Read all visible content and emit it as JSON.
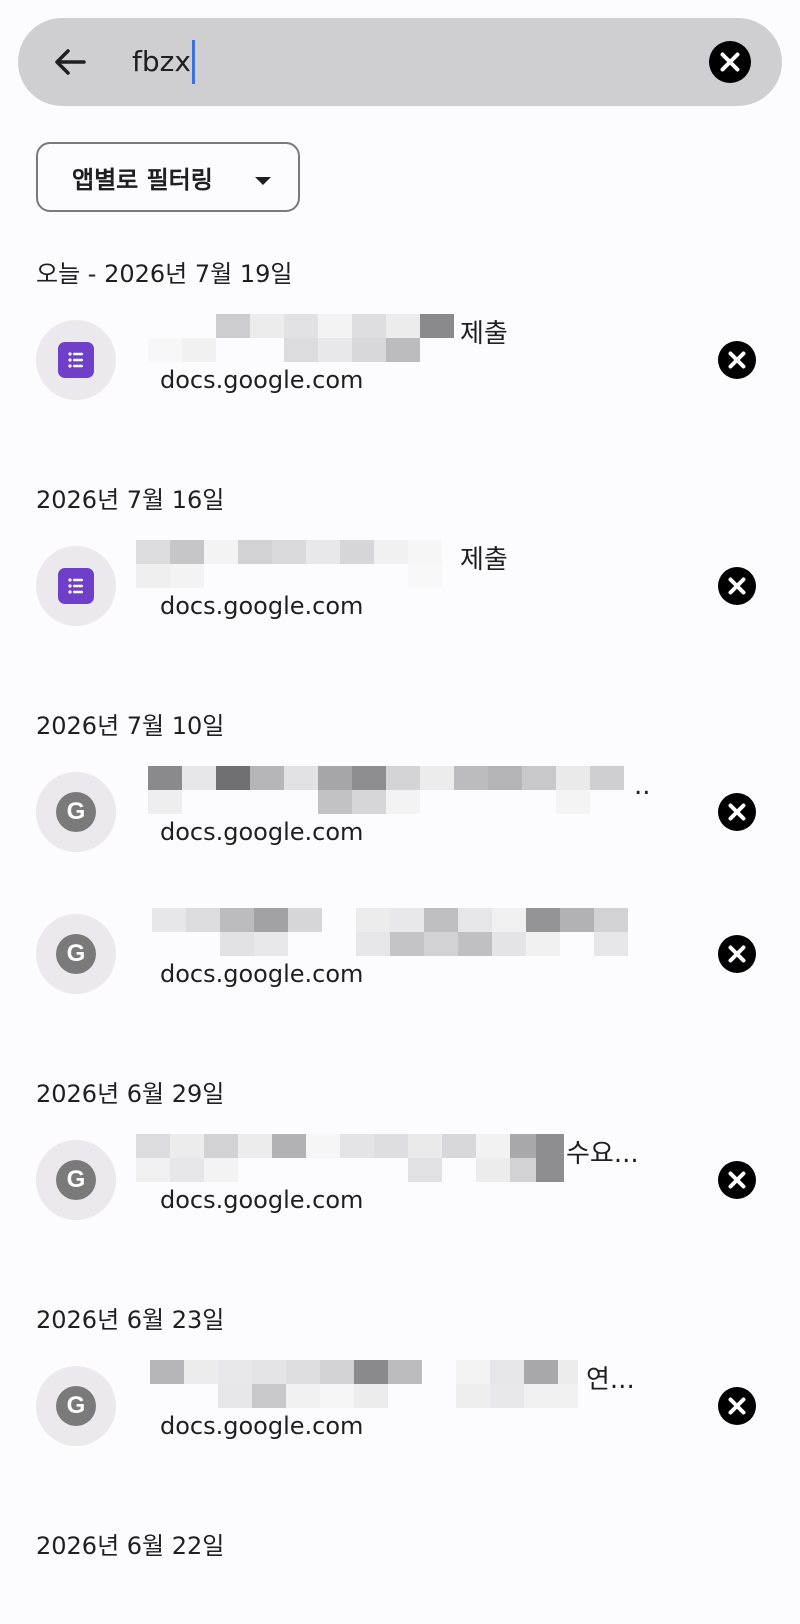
{
  "search": {
    "query": "fbzx"
  },
  "filter": {
    "label": "앱별로 필터링"
  },
  "groups": [
    {
      "date": "오늘 - 2026년 7월 19일"
    },
    {
      "date": "2026년 7월 16일"
    },
    {
      "date": "2026년 7월 10일"
    },
    {
      "date": "2026년 6월 29일"
    },
    {
      "date": "2026년 6월 23일"
    },
    {
      "date": "2026년 6월 22일"
    }
  ],
  "items": [
    {
      "icon": "forms-icon",
      "title_visible": "제출",
      "url": "docs.google.com"
    },
    {
      "icon": "forms-icon",
      "title_visible": "제출",
      "url": "docs.google.com"
    },
    {
      "icon": "g-icon",
      "icon_letter": "G",
      "title_visible": "..",
      "url": "docs.google.com"
    },
    {
      "icon": "g-icon",
      "icon_letter": "G",
      "title_visible": "",
      "url": "docs.google.com"
    },
    {
      "icon": "g-icon",
      "icon_letter": "G",
      "title_visible": "수요...",
      "url": "docs.google.com"
    },
    {
      "icon": "g-icon",
      "icon_letter": "G",
      "title_visible": "연...",
      "url": "docs.google.com"
    }
  ],
  "colors": {
    "search_bg": "#cfcfd1",
    "page_bg": "#fcfbfe",
    "forms_purple": "#6f3fc9",
    "g_gray": "#7a7a7a",
    "caret_blue": "#3d6fe0"
  }
}
